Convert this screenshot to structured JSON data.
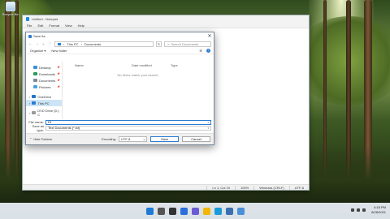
{
  "desktop": {
    "recycle_label": "Recycle Bin"
  },
  "notepad": {
    "title": "Untitled - Notepad",
    "menu": [
      "File",
      "Edit",
      "Format",
      "View",
      "Help"
    ],
    "status": [
      "Ln 1, Col 19",
      "100%",
      "Windows (CRLF)",
      "UTF-8"
    ]
  },
  "dialog": {
    "title": "Save As",
    "breadcrumb": [
      "This PC",
      "Documents"
    ],
    "search_placeholder": "Search Documents",
    "toolbar": {
      "organize": "Organize ▾",
      "new_folder": "New folder"
    },
    "nav_items": [
      {
        "label": "Desktop",
        "pinned": true
      },
      {
        "label": "Downloads",
        "pinned": true
      },
      {
        "label": "Documents",
        "pinned": true
      },
      {
        "label": "Pictures",
        "pinned": true
      },
      {
        "label": "OneDrive",
        "pinned": false
      },
      {
        "label": "This PC",
        "pinned": false
      },
      {
        "label": "DVD Drive (D:) C",
        "pinned": false
      }
    ],
    "columns": [
      "Name",
      "Date modified",
      "Type"
    ],
    "empty_message": "No items match your search.",
    "file_name_label": "File name:",
    "file_name_value": "Fil",
    "save_type_label": "Save as type:",
    "save_type_value": "Text Documents (*.txt)",
    "hide_folders": "Hide Folders",
    "encoding_label": "Encoding:",
    "encoding_value": "UTF-8",
    "save_button": "Save",
    "cancel_button": "Cancel"
  },
  "taskbar": {
    "time": "4:18 PM",
    "date": "8/28/2021"
  }
}
